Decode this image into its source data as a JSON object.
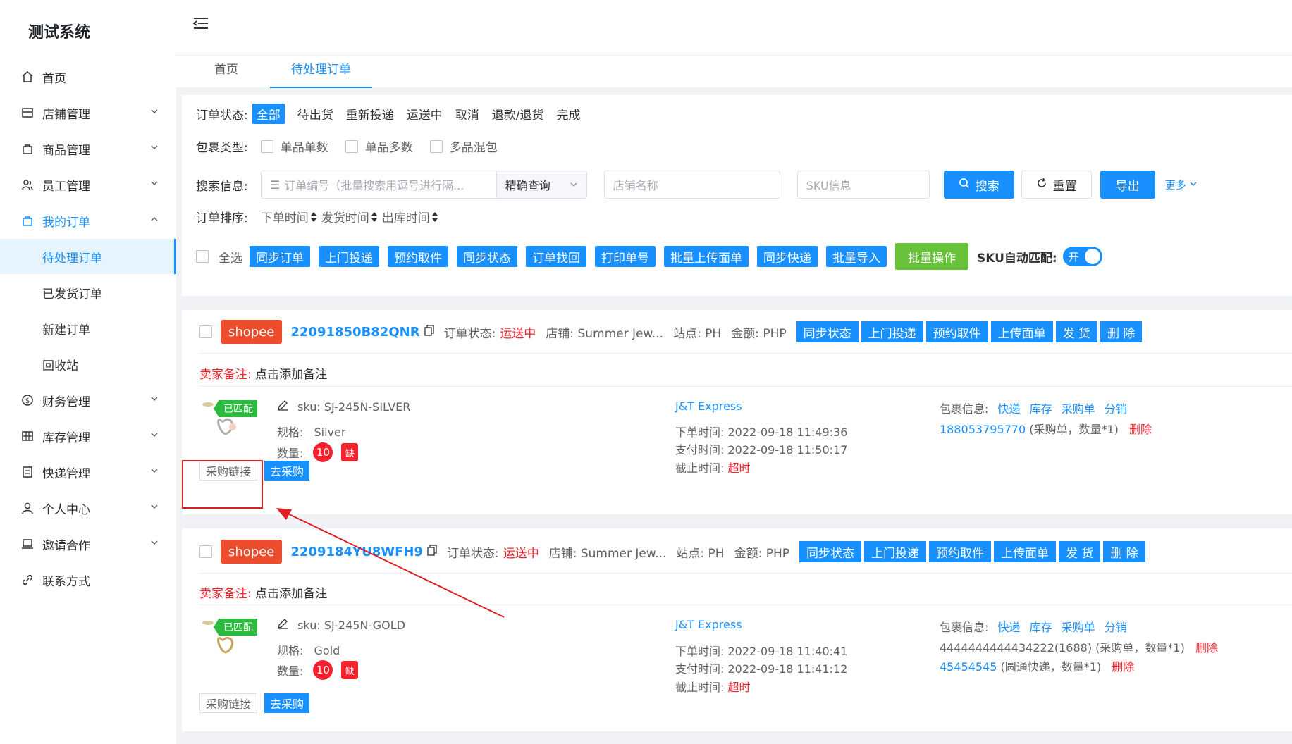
{
  "app": {
    "title": "测试系统"
  },
  "sidebar": {
    "items": [
      {
        "label": "首页",
        "icon": "home-icon"
      },
      {
        "label": "店铺管理",
        "icon": "store-icon"
      },
      {
        "label": "商品管理",
        "icon": "bag-icon"
      },
      {
        "label": "员工管理",
        "icon": "users-icon"
      },
      {
        "label": "我的订单",
        "icon": "cart-icon"
      },
      {
        "label": "待处理订单"
      },
      {
        "label": "已发货订单"
      },
      {
        "label": "新建订单"
      },
      {
        "label": "回收站"
      },
      {
        "label": "财务管理",
        "icon": "money-icon"
      },
      {
        "label": "库存管理",
        "icon": "grid-icon"
      },
      {
        "label": "快递管理",
        "icon": "list-icon"
      },
      {
        "label": "个人中心",
        "icon": "user-icon"
      },
      {
        "label": "邀请合作",
        "icon": "laptop-icon"
      },
      {
        "label": "联系方式",
        "icon": "link-icon"
      }
    ]
  },
  "tabs": [
    "首页",
    "待处理订单"
  ],
  "filters": {
    "status_label": "订单状态:",
    "status_options": [
      "全部",
      "待出货",
      "重新投递",
      "运送中",
      "取消",
      "退款/退货",
      "完成"
    ],
    "package_label": "包裹类型:",
    "package_options": [
      "单品单数",
      "单品多数",
      "多品混包"
    ],
    "search_label": "搜索信息:",
    "order_placeholder": "订单编号（批量搜索用逗号进行隔...",
    "match_select": "精确查询",
    "store_placeholder": "店铺名称",
    "sku_placeholder": "SKU信息",
    "search_btn": "搜索",
    "reset_btn": "重置",
    "export_btn": "导出",
    "more": "更多",
    "sort_label": "订单排序:",
    "sort_options": [
      "下单时间",
      "发货时间",
      "出库时间"
    ],
    "select_all": "全选",
    "batch_buttons": [
      "同步订单",
      "上门投递",
      "预约取件",
      "同步状态",
      "订单找回",
      "打印单号",
      "批量上传面单",
      "同步快递",
      "批量导入"
    ],
    "batch_op": "批量操作",
    "sku_auto_label": "SKU自动匹配:",
    "sku_auto_toggle": "开"
  },
  "orders": [
    {
      "platform": "shopee",
      "order_no": "22091850B82QNR",
      "status_label": "订单状态:",
      "status": "运送中",
      "store": "店铺: Summer Jew...",
      "site": "站点: PH",
      "amount": "金额: PHP",
      "actions": [
        "同步状态",
        "上门投递",
        "预约取件",
        "上传面单",
        "发 货",
        "删 除"
      ],
      "note_label": "卖家备注:",
      "note": "点击添加备注",
      "matched": "已匹配",
      "sku": "sku: SJ-245N-SILVER",
      "spec_label": "规格:",
      "spec": "Silver",
      "qty_label": "数量:",
      "qty": "10",
      "shortage": "缺",
      "link_btn": "采购链接",
      "buy_btn": "去采购",
      "carrier": "J&T Express",
      "order_time": "下单时间: 2022-09-18 11:49:36",
      "pay_time": "支付时间: 2022-09-18 11:50:17",
      "deadline_label": "截止时间:",
      "deadline": "超时",
      "pkg_label": "包裹信息:",
      "pkg_links": [
        "快递",
        "库存",
        "采购单",
        "分销"
      ],
      "pkg_entries": [
        {
          "id": "188053795770",
          "desc": " (采购单，数量*1)",
          "del": "删除",
          "id_blue": true
        }
      ]
    },
    {
      "platform": "shopee",
      "order_no": "2209184YU8WFH9",
      "status_label": "订单状态:",
      "status": "运送中",
      "store": "店铺: Summer Jew...",
      "site": "站点: PH",
      "amount": "金额: PHP",
      "actions": [
        "同步状态",
        "上门投递",
        "预约取件",
        "上传面单",
        "发 货",
        "删 除"
      ],
      "note_label": "卖家备注:",
      "note": "点击添加备注",
      "matched": "已匹配",
      "sku": "sku: SJ-245N-GOLD",
      "spec_label": "规格:",
      "spec": "Gold",
      "qty_label": "数量:",
      "qty": "10",
      "shortage": "缺",
      "link_btn": "采购链接",
      "buy_btn": "去采购",
      "carrier": "J&T Express",
      "order_time": "下单时间: 2022-09-18 11:40:41",
      "pay_time": "支付时间: 2022-09-18 11:41:12",
      "deadline_label": "截止时间:",
      "deadline": "超时",
      "pkg_label": "包裹信息:",
      "pkg_links": [
        "快递",
        "库存",
        "采购单",
        "分销"
      ],
      "pkg_entries": [
        {
          "id": "4444444444434222(1688)",
          "desc": " (采购单，数量*1)",
          "del": "删除",
          "id_blue": false
        },
        {
          "id": "45454545",
          "desc": " (圆通快递，数量*1)",
          "del": "删除",
          "id_blue": true
        }
      ]
    }
  ],
  "colors": {
    "primary": "#1890ff",
    "danger": "#f5222d",
    "shopee": "#ee4d2d",
    "success": "#67c23a",
    "annotation": "#e02020"
  }
}
